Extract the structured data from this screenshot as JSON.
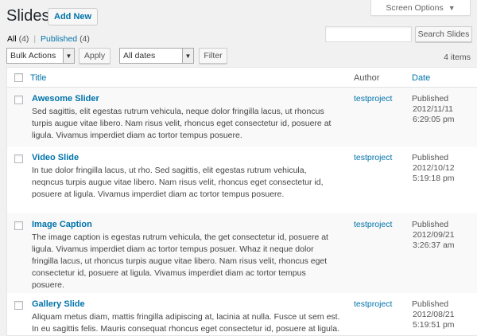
{
  "page": {
    "title": "Slides",
    "add_new_label": "Add New",
    "screen_options_label": "Screen Options"
  },
  "filters": {
    "all_label": "All",
    "all_count": "(4)",
    "published_label": "Published",
    "published_count": "(4)",
    "separator": "|"
  },
  "search": {
    "value": "",
    "button_label": "Search Slides"
  },
  "tablenav": {
    "bulk_actions_label": "Bulk Actions",
    "apply_label": "Apply",
    "dates_label": "All dates",
    "filter_label": "Filter",
    "items_count": "4 items"
  },
  "table": {
    "columns": {
      "title": "Title",
      "author": "Author",
      "date": "Date"
    },
    "rows": [
      {
        "title": "Awesome Slider",
        "excerpt": "Sed sagittis, elit egestas rutrum vehicula, neque dolor fringilla lacus, ut rhoncus turpis augue vitae libero. Nam risus velit, rhoncus eget consectetur id, posuere at ligula. Vivamus imperdiet diam ac tortor tempus posuere.",
        "author": "testproject",
        "status": "Published",
        "date": "2012/11/11",
        "time": "6:29:05 pm"
      },
      {
        "title": "Video Slide",
        "excerpt": "In tue dolor fringilla lacus, ut rho. Sed sagittis, elit egestas rutrum vehicula, neqncus turpis augue vitae libero. Nam risus velit, rhoncus eget consectetur id, posuere at ligula. Vivamus imperdiet diam ac tortor tempus posuere.",
        "author": "testproject",
        "status": "Published",
        "date": "2012/10/12",
        "time": "5:19:18 pm"
      },
      {
        "title": "Image Caption",
        "excerpt": "The image caption is egestas rutrum vehicula, the get consectetur id, posuere at ligula. Vivamus imperdiet diam ac tortor tempus posuer. Whaz it neque dolor fringilla lacus, ut rhoncus turpis augue vitae libero. Nam risus velit, rhoncus eget consectetur id, posuere at ligula. Vivamus imperdiet diam ac tortor tempus posuere.",
        "author": "testproject",
        "status": "Published",
        "date": "2012/09/21",
        "time": "3:26:37 am"
      },
      {
        "title": "Gallery Slide",
        "excerpt": "Aliquam metus diam, mattis fringilla adipiscing at, lacinia at nulla. Fusce ut sem est. In eu sagittis felis. Mauris consequat rhoncus eget consectetur id, posuere at ligula. Cras tortor elit, aliquet",
        "author": "testproject",
        "status": "Published",
        "date": "2012/08/21",
        "time": "5:19:51 pm"
      }
    ]
  },
  "icons": {
    "dropdown": "triangle-down-icon",
    "checkbox": "checkbox-icon"
  }
}
